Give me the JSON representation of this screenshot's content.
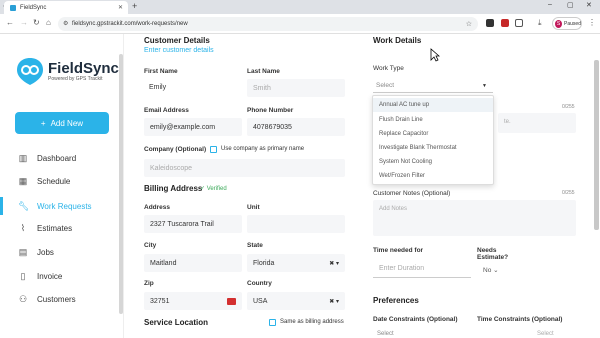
{
  "browser": {
    "tab_title": "FieldSync",
    "url": "fieldsync.gpstrackit.com/work-requests/new",
    "profile_label": "Paused",
    "profile_initial": "S"
  },
  "sidebar": {
    "brand": "FieldSync",
    "brand_sub": "Powered by GPS Trackit",
    "add_new": "Add New",
    "items": [
      {
        "label": "Dashboard",
        "icon": "bar-chart-icon"
      },
      {
        "label": "Schedule",
        "icon": "calendar-icon"
      },
      {
        "label": "Work Requests",
        "icon": "wrench-icon"
      },
      {
        "label": "Estimates",
        "icon": "paperclip-icon"
      },
      {
        "label": "Jobs",
        "icon": "briefcase-icon"
      },
      {
        "label": "Invoice",
        "icon": "document-icon"
      },
      {
        "label": "Customers",
        "icon": "people-icon"
      }
    ]
  },
  "customer": {
    "title": "Customer Details",
    "enter_link": "Enter customer details",
    "first_name_label": "First Name",
    "first_name": "Emily",
    "last_name_label": "Last Name",
    "last_name": "Smith",
    "email_label": "Email Address",
    "email": "emily@example.com",
    "phone_label": "Phone Number",
    "phone": "4078679035",
    "company_label": "Company (Optional)",
    "company_checkbox": "Use company as primary name",
    "company": "Kaleidoscope"
  },
  "billing": {
    "title": "Billing Address",
    "verified": "Verified",
    "address_label": "Address",
    "address": "2327 Tuscarora Trail",
    "unit_label": "Unit",
    "city_label": "City",
    "city": "Maitland",
    "state_label": "State",
    "state": "Florida",
    "zip_label": "Zip",
    "zip": "32751",
    "country_label": "Country",
    "country": "USA"
  },
  "service": {
    "title": "Service Location",
    "same_as": "Same as billing address"
  },
  "work": {
    "title": "Work Details",
    "type_label": "Work Type",
    "type_placeholder": "Select",
    "options": [
      "Annual AC tune up",
      "Flush Drain Line",
      "Replace Capacitor",
      "Investigate Blank Thermostat",
      "System Not Cooling",
      "Wet/Frozen Filter"
    ],
    "counter1": "0/255",
    "hidden_hint": "te.",
    "notes_label": "Customer Notes (Optional)",
    "counter2": "0/255",
    "notes_placeholder": "Add Notes",
    "time_label": "Time needed for",
    "time_placeholder": "Enter Duration",
    "estimate_label": "Needs Estimate?",
    "estimate_value": "No"
  },
  "preferences": {
    "title": "Preferences",
    "date_label": "Date Constraints (Optional)",
    "time_label": "Time Constraints (Optional)",
    "date_value": "Select",
    "time_value": "Select"
  },
  "colors": {
    "accent": "#2bb3e8",
    "verified": "#3caa5a"
  }
}
